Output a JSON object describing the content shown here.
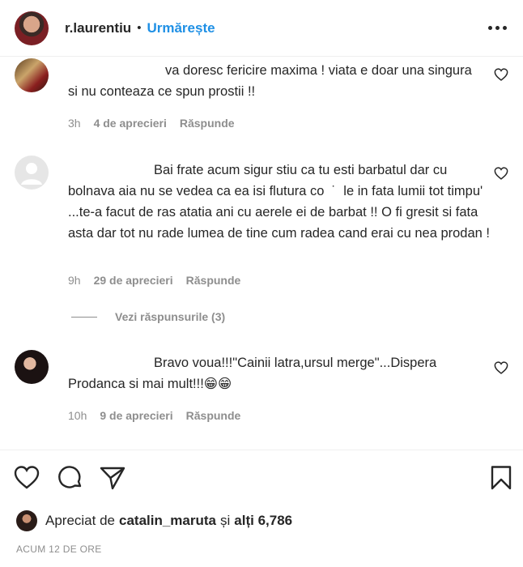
{
  "header": {
    "username": "r.laurentiu",
    "separator": "•",
    "follow_label": "Urmărește"
  },
  "comments": [
    {
      "username": "",
      "text": "va doresc fericire maxima ! viata e doar una singura si nu conteaza ce spun prostii !!",
      "time": "3h",
      "likes": "4 de aprecieri",
      "reply_label": "Răspunde"
    },
    {
      "username": "",
      "text": "Bai frate acum sigur stiu ca tu esti barbatul dar cu bolnava aia nu se vedea ca ea isi flutura co  ˙  le in fata lumii tot timpu' ...te-a facut de ras atatia ani cu aerele ei de barbat !! O fi gresit si fata asta dar tot nu rade lumea de tine cum radea cand erai cu nea prodan !",
      "time": "9h",
      "likes": "29 de aprecieri",
      "reply_label": "Răspunde",
      "replies_label": "Vezi răspunsurile (3)"
    },
    {
      "username": "",
      "text": "Bravo voua!!!\"Cainii latra,ursul merge\"...Dispera Prodanca si mai mult!!!😁😁",
      "time": "10h",
      "likes": "9 de aprecieri",
      "reply_label": "Răspunde"
    }
  ],
  "likes_line": {
    "prefix": "Apreciat de",
    "user": "catalin_maruta",
    "middle": "și",
    "others": "alți 6,786"
  },
  "timestamp": "ACUM 12 DE ORE",
  "icons": {
    "comment_like": "heart-outline-icon",
    "like": "heart-outline-icon",
    "comment": "speech-bubble-icon",
    "share": "paper-plane-icon",
    "save": "bookmark-icon",
    "more": "three-dots-icon"
  },
  "colors": {
    "follow": "#1f90e5",
    "text": "#262626",
    "secondary": "#8e8e8e"
  }
}
